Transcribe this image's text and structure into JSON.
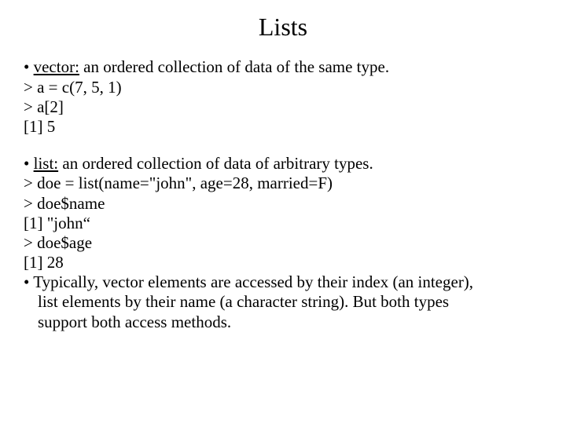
{
  "title": "Lists",
  "section1": {
    "bullet_prefix": "• ",
    "term": "vector:",
    "desc": " an ordered collection of data of the same type.",
    "code1": "> a = c(7, 5, 1)",
    "code2": "> a[2]",
    "code3": "[1] 5"
  },
  "section2": {
    "bullet_prefix": "• ",
    "term": "list:",
    "desc": " an ordered collection of data of arbitrary types.",
    "code1": "> doe = list(name=\"john\", age=28, married=F)",
    "code2": "> doe$name",
    "code3": "[1] \"john“",
    "code4": "> doe$age",
    "code5": "[1] 28"
  },
  "section3": {
    "bullet": "• Typically, vector elements are accessed by their index (an integer),",
    "cont1": "list elements by their name (a character string). But both types",
    "cont2": "support both access methods."
  }
}
